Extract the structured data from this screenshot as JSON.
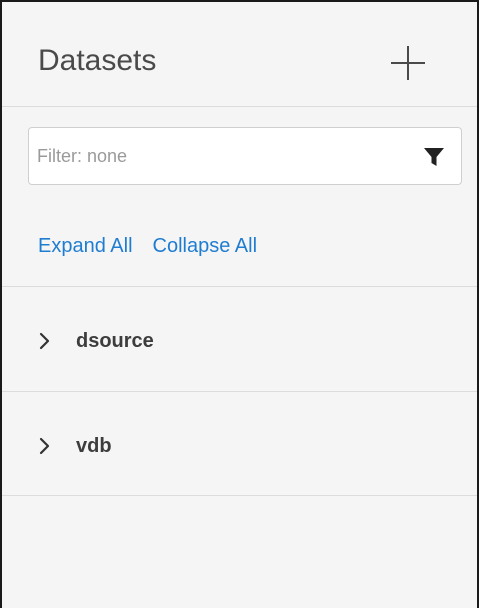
{
  "header": {
    "title": "Datasets",
    "add_icon": "plus-icon"
  },
  "filter": {
    "value": "",
    "placeholder": "Filter: none",
    "icon": "funnel-filter-icon"
  },
  "actions": {
    "expand_all": "Expand All",
    "collapse_all": "Collapse All"
  },
  "tree": {
    "items": [
      {
        "label": "dsource",
        "icon": "chevron-right-icon",
        "expanded": false
      },
      {
        "label": "vdb",
        "icon": "chevron-right-icon",
        "expanded": false
      }
    ]
  },
  "colors": {
    "link": "#1f7dd1",
    "panel_background": "#f5f5f5",
    "divider": "#dcdcdc",
    "title_text": "#4a4a4a"
  }
}
